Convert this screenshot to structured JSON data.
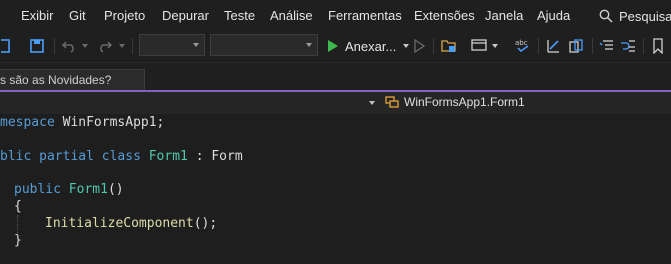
{
  "menu": [
    "Exibir",
    "Git",
    "Projeto",
    "Depurar",
    "Teste",
    "Análise",
    "Ferramentas",
    "Extensões",
    "Janela",
    "Ajuda"
  ],
  "search": {
    "label": "Pesquisar"
  },
  "toolbar": {
    "run_label": "Anexar..."
  },
  "tabs": {
    "news_label": "s são as Novidades?"
  },
  "navbar": {
    "member": "WinFormsApp1.Form1"
  },
  "code": {
    "namespace_kw": "mespace",
    "namespace_name": "WinFormsApp1",
    "semicolon": ";",
    "class_mod1": "blic",
    "class_mod2": "partial",
    "class_kw": "class",
    "class_name": "Form1",
    "colon": ":",
    "base_class": "Form",
    "ctor_mod": "public",
    "ctor_name": "Form1",
    "ctor_parens": "()",
    "open_brace": "{",
    "call_name": "InitializeComponent",
    "call_rest": "();",
    "close_brace": "}"
  },
  "colors": {
    "accent": "#8661c5",
    "keyword": "#569cd6",
    "type": "#4ec9b0",
    "method": "#dcdcaa",
    "run": "#3fb950"
  }
}
